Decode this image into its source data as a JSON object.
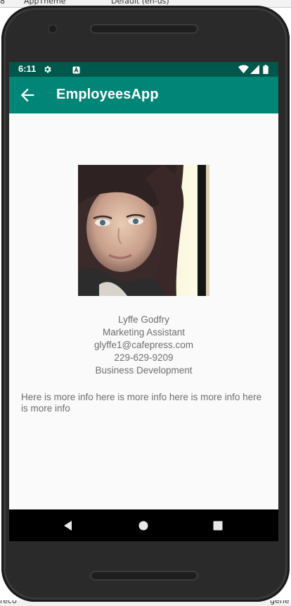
{
  "ide": {
    "top_left_text": "8",
    "theme_label": "AppTheme",
    "locale_label": "Default (en-us)",
    "bottom_left_text": "reco",
    "bottom_right_text": "gene"
  },
  "status_bar": {
    "time": "6:11",
    "icons": [
      "settings-icon",
      "notification-a-icon",
      "wifi-icon",
      "signal-icon",
      "battery-icon"
    ]
  },
  "app_bar": {
    "title": "EmployeesApp",
    "back_icon": "arrow-left-icon",
    "color": "#008577",
    "status_color": "#00574b"
  },
  "employee": {
    "name": "Lyffe Godfry",
    "job_title": "Marketing Assistant",
    "email": "glyffe1@cafepress.com",
    "phone": "229-629-9209",
    "department": "Business Development",
    "more_info": "Here is more info here is more info here is more info here is more info"
  },
  "nav_bar": {
    "buttons": [
      "back-triangle-icon",
      "home-circle-icon",
      "recents-square-icon"
    ]
  }
}
